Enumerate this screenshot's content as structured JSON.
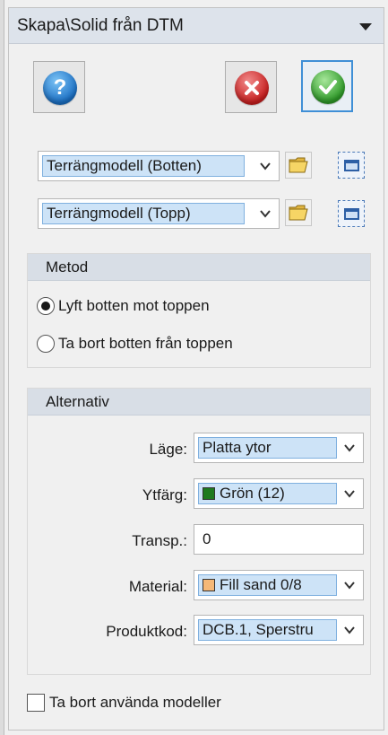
{
  "window": {
    "title": "Skapa\\Solid från DTM",
    "menu_icon": "dropdown-triangle-icon"
  },
  "toolbar": {
    "help_icon": "help-icon",
    "cancel_icon": "cancel-icon",
    "ok_icon": "ok-checkmark-icon"
  },
  "surfaces": {
    "bottom": {
      "value": "Terrängmodell (Botten)"
    },
    "top": {
      "value": "Terrängmodell (Topp)"
    }
  },
  "method": {
    "header": "Metod",
    "options": [
      {
        "label": "Lyft botten mot toppen",
        "selected": true
      },
      {
        "label": "Ta bort botten från toppen",
        "selected": false
      }
    ]
  },
  "alternatives": {
    "header": "Alternativ",
    "mode": {
      "label": "Läge:",
      "value": "Platta ytor"
    },
    "surface_color": {
      "label": "Ytfärg:",
      "value": "Grön (12)",
      "swatch": "#1f7a1f"
    },
    "transparency": {
      "label": "Transp.:",
      "value": "0"
    },
    "material": {
      "label": "Material:",
      "value": "Fill sand 0/8",
      "swatch": "#f5b877"
    },
    "product_code": {
      "label": "Produktkod:",
      "value": "DCB.1, Sperstru"
    }
  },
  "remove_used": {
    "label": "Ta bort använda modeller",
    "checked": false
  },
  "colors": {
    "accent": "#3f8fd6",
    "header_bg": "#dde3eb",
    "selection": "#cde3f7"
  }
}
